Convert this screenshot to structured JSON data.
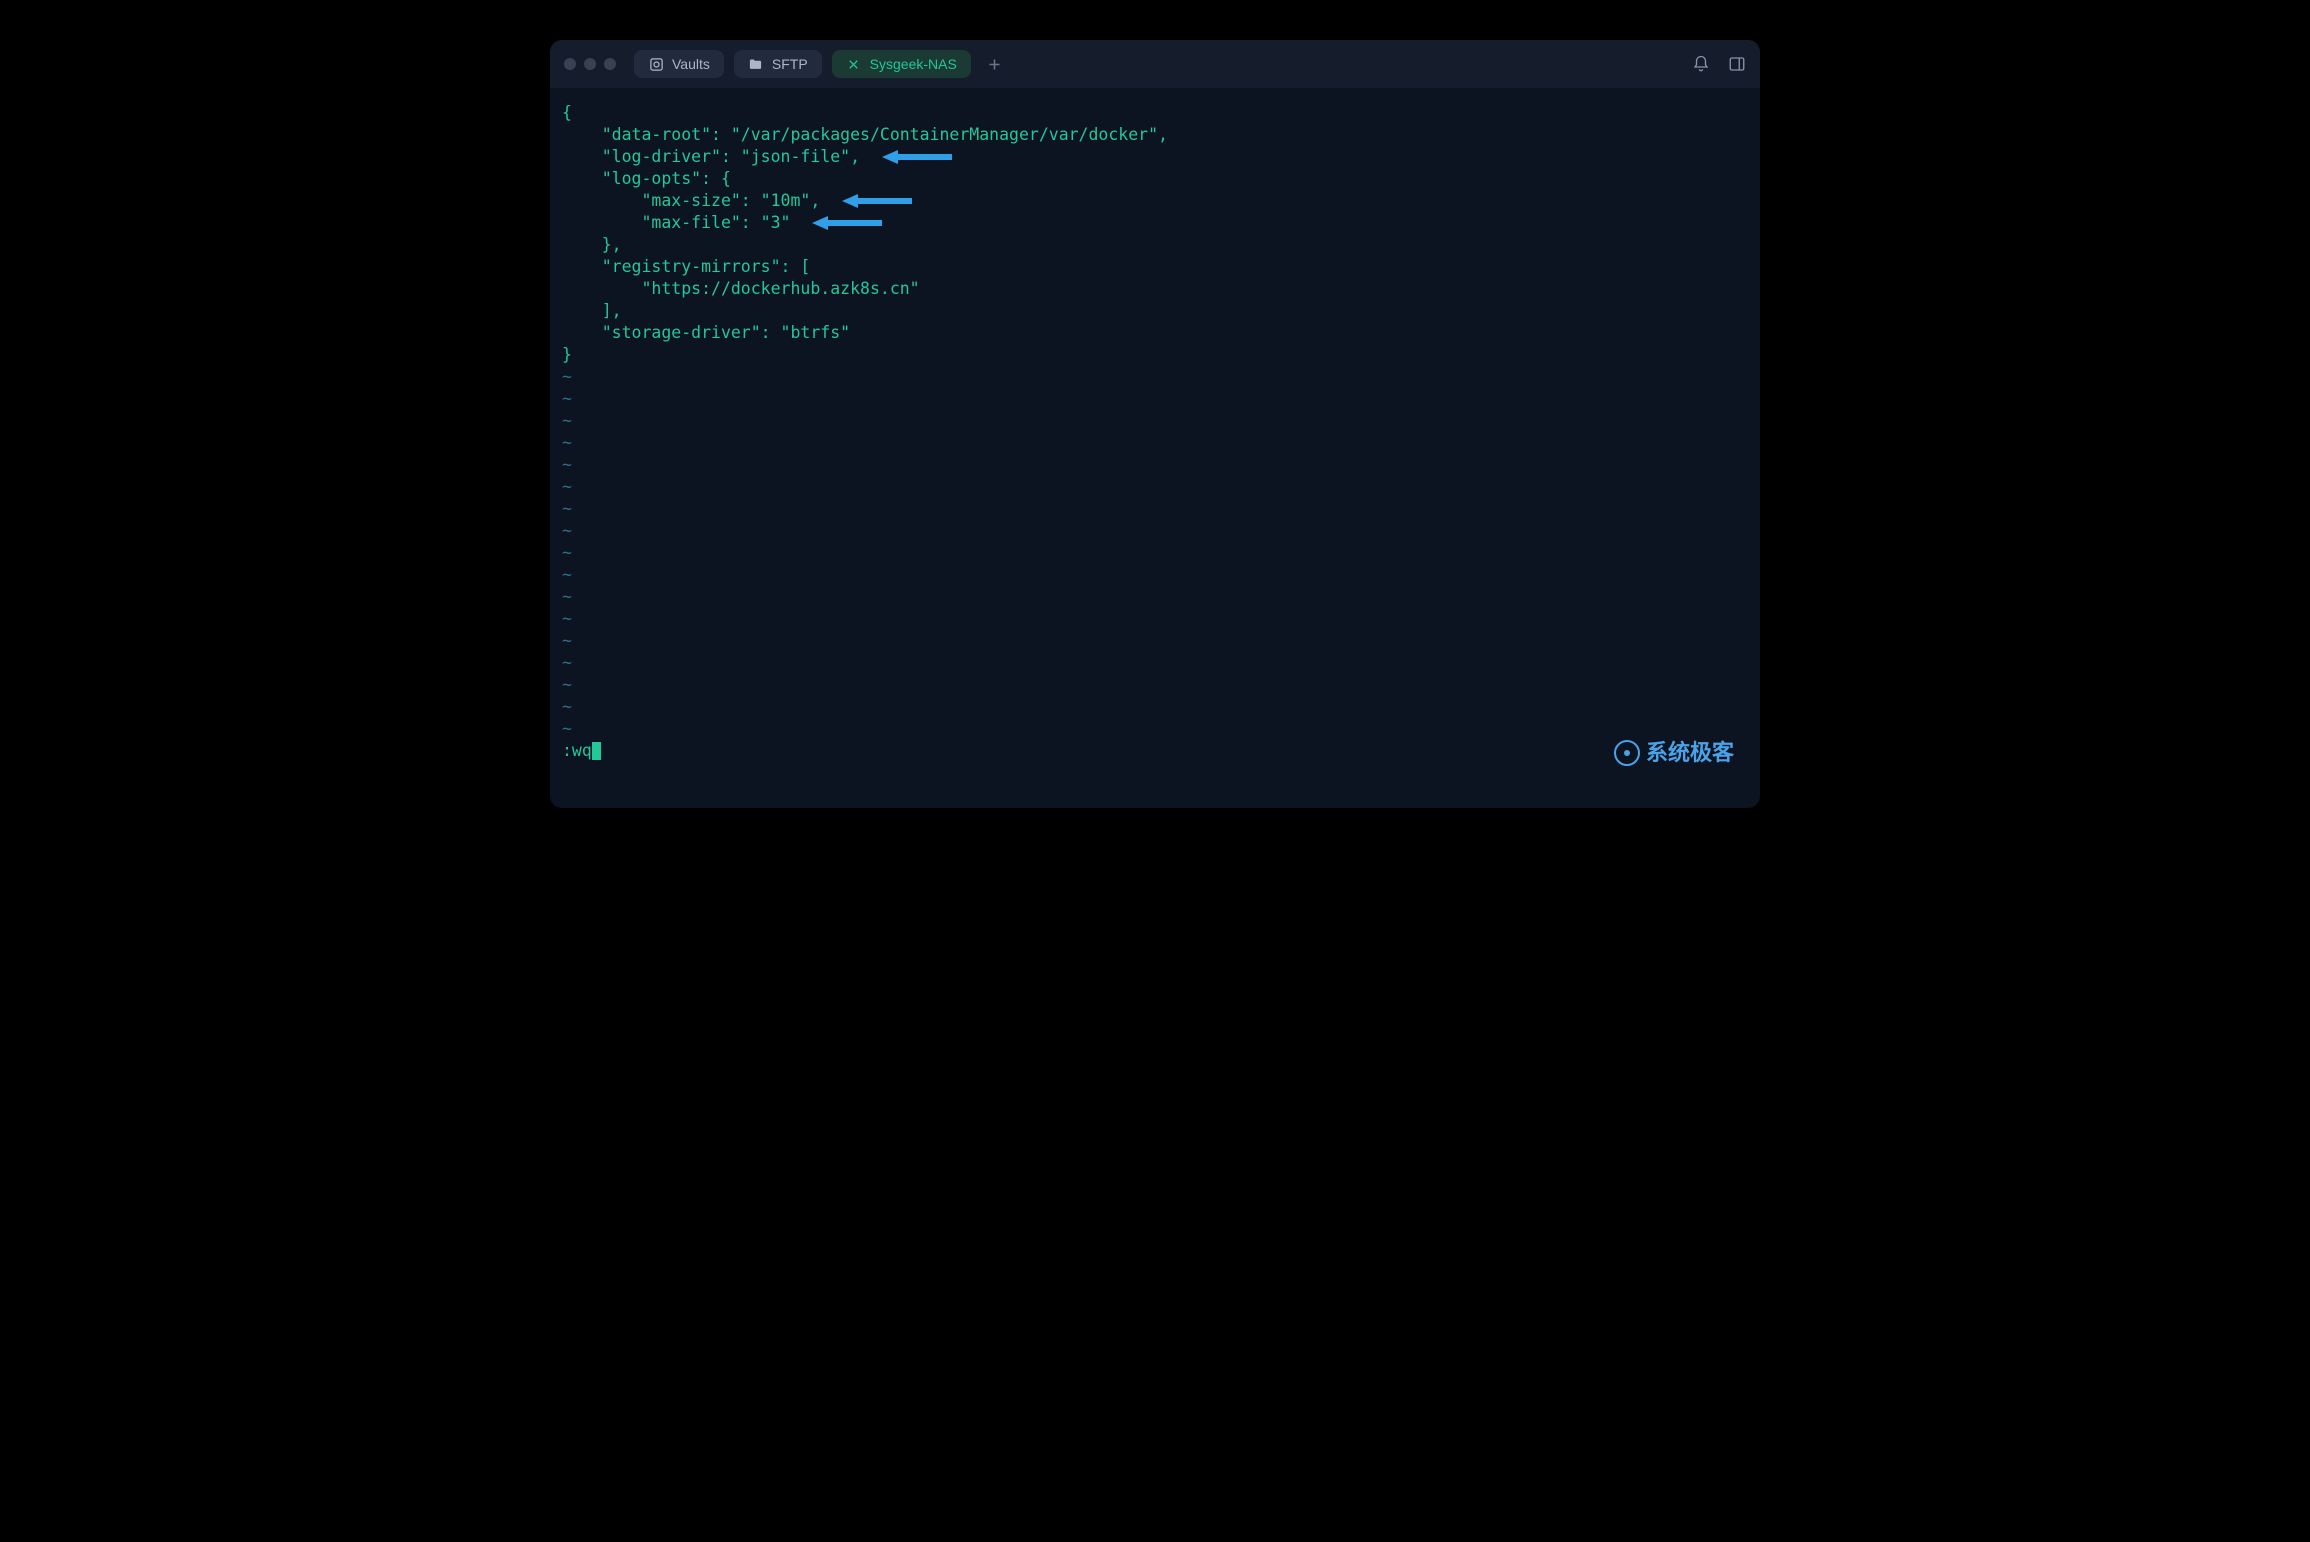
{
  "tabs": {
    "vaults": {
      "label": "Vaults"
    },
    "sftp": {
      "label": "SFTP"
    },
    "active": {
      "label": "Sysgeek-NAS"
    }
  },
  "editor": {
    "lines": [
      "{",
      "    \"data-root\": \"/var/packages/ContainerManager/var/docker\",",
      "    \"log-driver\": \"json-file\",",
      "    \"log-opts\": {",
      "        \"max-size\": \"10m\",",
      "        \"max-file\": \"3\"",
      "    },",
      "    \"registry-mirrors\": [",
      "        \"https://dockerhub.azk8s.cn\"",
      "    ],",
      "    \"storage-driver\": \"btrfs\"",
      "}"
    ],
    "tilde": "~",
    "tilde_count": 17,
    "command": ":wq"
  },
  "arrow_targets": [
    2,
    4,
    5
  ],
  "watermark": {
    "text": "系统极客"
  }
}
